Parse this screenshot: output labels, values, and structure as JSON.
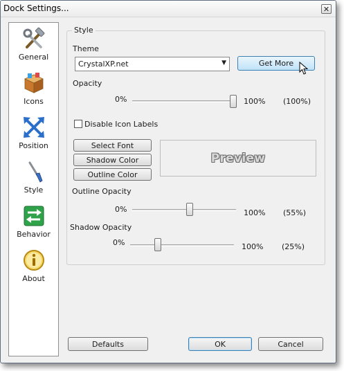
{
  "window": {
    "title": "Dock Settings...",
    "close_glyph": "✕"
  },
  "sidebar": {
    "items": [
      {
        "label": "General",
        "icon": "tools-icon"
      },
      {
        "label": "Icons",
        "icon": "box-icon"
      },
      {
        "label": "Position",
        "icon": "move-arrows-icon"
      },
      {
        "label": "Style",
        "icon": "paintbrush-icon"
      },
      {
        "label": "Behavior",
        "icon": "exchange-arrows-icon"
      },
      {
        "label": "About",
        "icon": "info-icon"
      }
    ],
    "selected": "Style"
  },
  "style": {
    "group_title": "Style",
    "theme_label": "Theme",
    "theme_value": "CrystalXP.net",
    "get_more_label": "Get More",
    "opacity_label": "Opacity",
    "opacity_min": "0%",
    "opacity_max": "100%",
    "opacity_value_text": "(100%)",
    "opacity_value": 100,
    "disable_labels_label": "Disable Icon Labels",
    "disable_labels_checked": false,
    "select_font_label": "Select Font",
    "shadow_color_label": "Shadow Color",
    "outline_color_label": "Outline Color",
    "preview_text": "Preview",
    "outline_opacity_label": "Outline Opacity",
    "outline_min": "0%",
    "outline_max": "100%",
    "outline_value_text": "(55%)",
    "outline_value": 55,
    "shadow_opacity_label": "Shadow Opacity",
    "shadow_min": "0%",
    "shadow_max": "100%",
    "shadow_value_text": "(25%)",
    "shadow_value": 25
  },
  "footer": {
    "defaults_label": "Defaults",
    "ok_label": "OK",
    "cancel_label": "Cancel"
  },
  "colors": {
    "accent_border": "#3c7fb1",
    "hot_button": "#bfe2f8",
    "window_bg": "#f0f0f0"
  }
}
